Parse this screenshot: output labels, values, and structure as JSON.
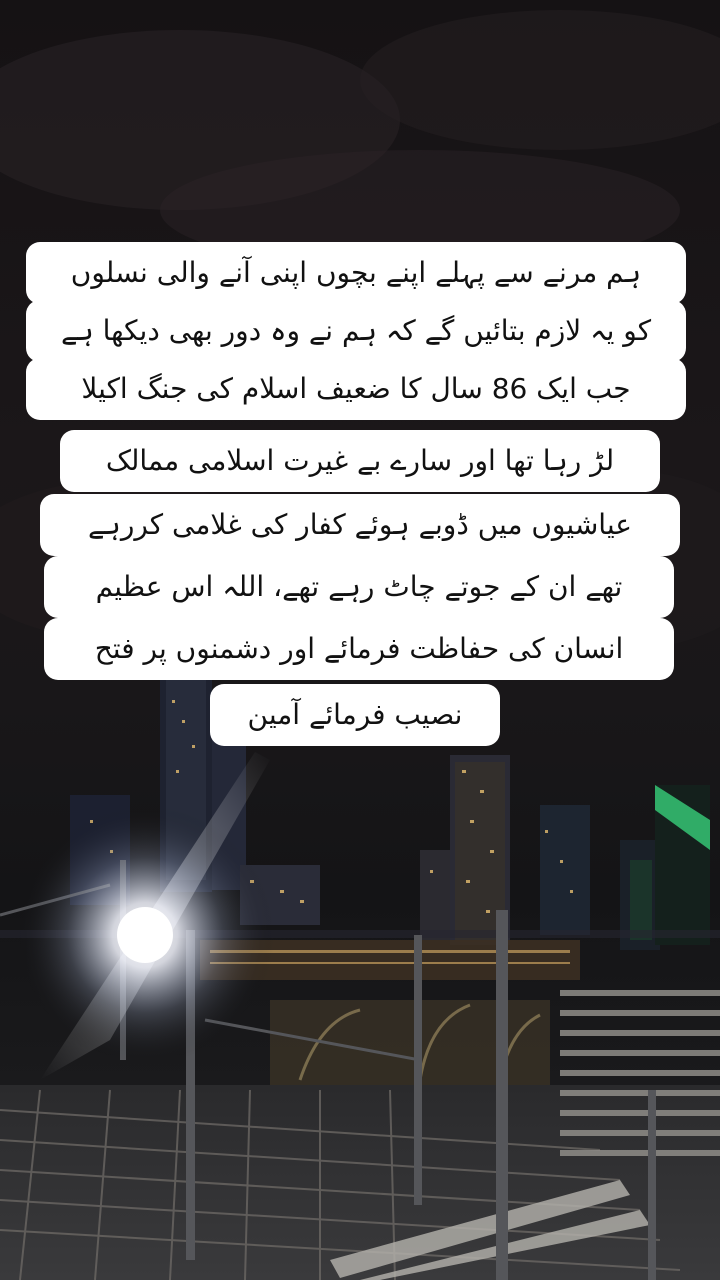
{
  "caption": {
    "lines": [
      "ہم مرنے سے پہلے اپنے بچوں اپنی آنے والی نسلوں",
      "کو یہ لازم بتائیں گے کہ ہم نے وہ دور بھی دیکھا ہے",
      "جب ایک 86 سال کا ضعیف اسلام کی جنگ اکیلا",
      "لڑ رہا تھا اور سارے بے غیرت اسلامی ممالک",
      "عیاشیوں میں ڈوبے ہوئے کفار کی غلامی کررہے",
      "تھے ان کے جوتے چاٹ رہے تھے، اللہ اس عظیم",
      "انسان کی حفاظت فرمائے اور دشمنوں پر فتح",
      "نصیب فرمائے آمین"
    ]
  },
  "colors": {
    "caption_bg": "#ffffff",
    "caption_text": "#111111",
    "sky": "#1a1618",
    "skyline_light": "#f2c774",
    "green_accent": "#37d07a"
  }
}
